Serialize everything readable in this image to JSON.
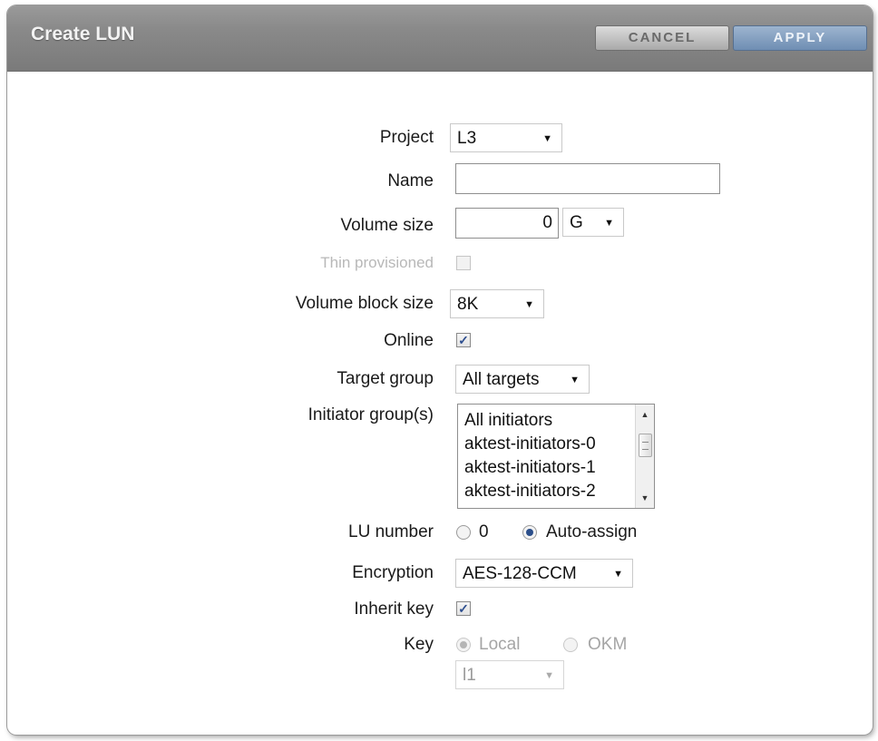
{
  "dialog": {
    "title": "Create LUN",
    "cancel_label": "CANCEL",
    "apply_label": "APPLY"
  },
  "form": {
    "project": {
      "label": "Project",
      "value": "L3"
    },
    "name": {
      "label": "Name",
      "value": ""
    },
    "volume_size": {
      "label": "Volume size",
      "value": "0",
      "unit": "G"
    },
    "thin_provisioned": {
      "label": "Thin provisioned",
      "checked": false,
      "disabled": true
    },
    "volume_block_size": {
      "label": "Volume block size",
      "value": "8K"
    },
    "online": {
      "label": "Online",
      "checked": true
    },
    "target_group": {
      "label": "Target group",
      "value": "All targets"
    },
    "initiator_groups": {
      "label": "Initiator group(s)",
      "items": [
        "All initiators",
        "aktest-initiators-0",
        "aktest-initiators-1",
        "aktest-initiators-2"
      ]
    },
    "lu_number": {
      "label": "LU number",
      "options": [
        "0",
        "Auto-assign"
      ],
      "selected": "Auto-assign"
    },
    "encryption": {
      "label": "Encryption",
      "value": "AES-128-CCM"
    },
    "inherit_key": {
      "label": "Inherit key",
      "checked": true
    },
    "key": {
      "label": "Key",
      "options": [
        "Local",
        "OKM"
      ],
      "selected": "Local",
      "disabled": true,
      "keystore_value": "l1"
    }
  },
  "icons": {
    "dropdown": "chevron-down-icon",
    "check": "checkmark-icon"
  },
  "colors": {
    "title_bar": "#8a8a8a",
    "apply_button": "#7f9cc0",
    "cancel_button": "#c4c4c4",
    "accent": "#2b4e8a"
  }
}
